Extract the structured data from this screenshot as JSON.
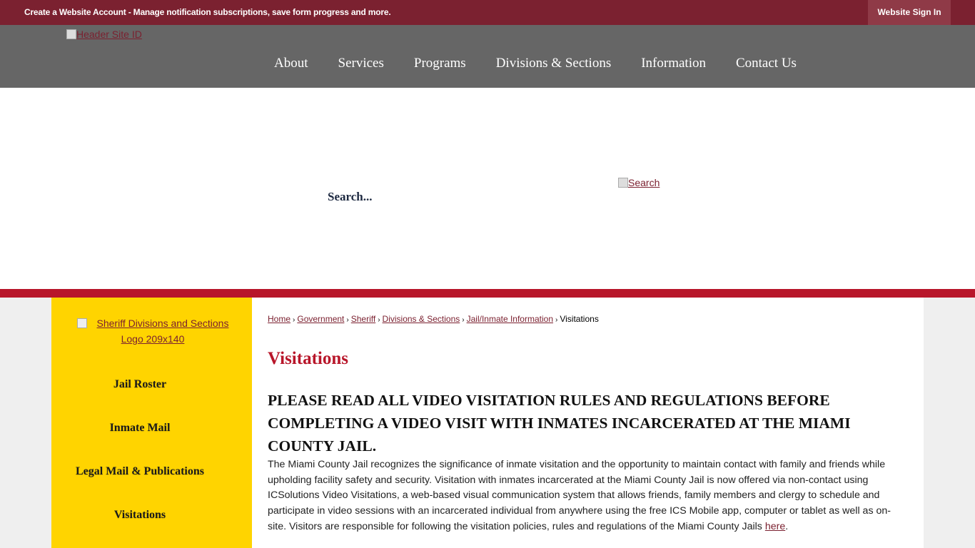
{
  "topbar": {
    "account_link": "Create a Website Account",
    "account_desc": " - Manage notification subscriptions, save form progress and more.",
    "signin": "Website Sign In"
  },
  "header": {
    "logo_alt": "Header Site ID",
    "nav": [
      "About",
      "Services",
      "Programs",
      "Divisions & Sections",
      "Information",
      "Contact Us"
    ]
  },
  "search": {
    "placeholder": "Search...",
    "button_alt": "Search"
  },
  "sidebar": {
    "logo_alt": "Sheriff Divisions and Sections Logo 209x140",
    "items": [
      "Jail Roster",
      "Inmate Mail",
      "Legal Mail & Publications",
      "Visitations"
    ]
  },
  "breadcrumb": {
    "links": [
      "Home",
      "Government",
      "Sheriff",
      "Divisions & Sections",
      "Jail/Inmate Information"
    ],
    "current": "Visitations",
    "separator": "›"
  },
  "page": {
    "title": "Visitations",
    "subheading": "PLEASE READ ALL VIDEO VISITATION RULES AND REGULATIONS BEFORE COMPLETING A VIDEO VISIT WITH INMATES INCARCERATED AT THE MIAMI COUNTY JAIL.",
    "body": "The Miami County Jail recognizes the significance of inmate visitation and the opportunity to maintain contact with family and friends while upholding facility safety and security. Visitation with inmates incarcerated at the Miami County Jail is now offered via non-contact using ICSolutions Video Visitations, a web-based visual communication system that allows friends, family members and clergy to schedule and participate in video sessions with an incarcerated individual from anywhere using the free ICS Mobile app, computer or tablet as well as on-site. Visitors are responsible for following the visitation policies, rules and regulations of the Miami County Jails ",
    "body_link": "here",
    "body_end": "."
  },
  "colors": {
    "topbar": "#7b2130",
    "header": "#666666",
    "accent_red": "#b8162a",
    "sidebar": "#ffd400"
  }
}
